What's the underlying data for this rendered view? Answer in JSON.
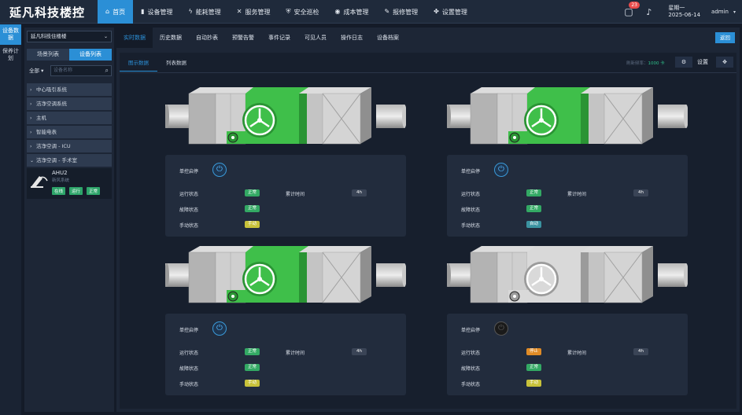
{
  "app": {
    "title": "延凡科技楼控"
  },
  "nav": {
    "items": [
      {
        "icon": "home-icon",
        "glyph": "⌂",
        "label": "首页"
      },
      {
        "icon": "device-icon",
        "glyph": "▮",
        "label": "设备管理"
      },
      {
        "icon": "energy-icon",
        "glyph": "ϟ",
        "label": "能耗管理"
      },
      {
        "icon": "service-icon",
        "glyph": "✕",
        "label": "服务管理"
      },
      {
        "icon": "shield-icon",
        "glyph": "⛨",
        "label": "安全巡检"
      },
      {
        "icon": "cost-icon",
        "glyph": "◉",
        "label": "成本管理"
      },
      {
        "icon": "wrench-icon",
        "glyph": "✎",
        "label": "报修管理"
      },
      {
        "icon": "puzzle-icon",
        "glyph": "✤",
        "label": "设置管理"
      }
    ]
  },
  "header": {
    "message_count": "23",
    "weekday": "星期一",
    "date": "2025-06-14",
    "user": "admin"
  },
  "leftnav": {
    "items": [
      "设备数据",
      "保养计划"
    ]
  },
  "sidebar": {
    "project": "延凡科技住楼楼",
    "tabs": [
      "场景列表",
      "设备列表"
    ],
    "filter": "全部",
    "search_placeholder": "设备名称",
    "tree": [
      {
        "label": "中心吸引系统",
        "arrow": "›"
      },
      {
        "label": "洁净空调系统",
        "arrow": "›"
      },
      {
        "label": "主机",
        "arrow": "›"
      },
      {
        "label": "智能电表",
        "arrow": "›"
      },
      {
        "label": "洁净空调 - ICU",
        "arrow": "›"
      },
      {
        "label": "洁净空调 - 手术室",
        "arrow": "⌄"
      }
    ],
    "device": {
      "name": "AHU2",
      "sub": "新风系统",
      "tags": [
        "在线",
        "运行",
        "正常"
      ]
    }
  },
  "main": {
    "tabs": [
      "实时数据",
      "历史数据",
      "自动抄表",
      "预警告警",
      "事件记录",
      "可见人员",
      "操作日志",
      "设备档案"
    ],
    "back": "返回",
    "subtabs": [
      "图示数据",
      "列表数据"
    ],
    "rate_label": "刷新频率：",
    "rate_value": "1000 卡",
    "settings": "设置"
  },
  "colors": {
    "accent": "#2b8fd6",
    "ok": "#33a964",
    "warn": "#c8c23a",
    "stop": "#e08b26",
    "auto": "#3b93a1"
  },
  "units": [
    {
      "fan_color": "#3fbf4a",
      "fan_dark": "#2a9434",
      "panel": {
        "title": "单控启停",
        "power": "on",
        "run_label": "运行状态",
        "run": "正常",
        "run_color": "green",
        "time_label": "累计时间",
        "time": "4h",
        "fault_label": "故障状态",
        "fault": "正常",
        "manual_label": "手动状态",
        "manual": "手动",
        "manual_color": "yellow"
      }
    },
    {
      "fan_color": "#3fbf4a",
      "fan_dark": "#2a9434",
      "panel": {
        "title": "单控启停",
        "power": "on",
        "run_label": "运行状态",
        "run": "正常",
        "run_color": "green",
        "time_label": "累计时间",
        "time": "4h",
        "fault_label": "故障状态",
        "fault": "正常",
        "manual_label": "手动状态",
        "manual": "自动",
        "manual_color": "teal"
      }
    },
    {
      "fan_color": "#3fbf4a",
      "fan_dark": "#2a9434",
      "panel": {
        "title": "单控启停",
        "power": "on",
        "run_label": "运行状态",
        "run": "正常",
        "run_color": "green",
        "time_label": "累计时间",
        "time": "4h",
        "fault_label": "故障状态",
        "fault": "正常",
        "manual_label": "手动状态",
        "manual": "手动",
        "manual_color": "yellow"
      }
    },
    {
      "fan_color": "#d9d9d9",
      "fan_dark": "#9b9b9b",
      "panel": {
        "title": "单控启停",
        "power": "off",
        "run_label": "运行状态",
        "run": "停止",
        "run_color": "orange",
        "time_label": "累计时间",
        "time": "4h",
        "fault_label": "故障状态",
        "fault": "正常",
        "manual_label": "手动状态",
        "manual": "手动",
        "manual_color": "yellow"
      }
    }
  ]
}
